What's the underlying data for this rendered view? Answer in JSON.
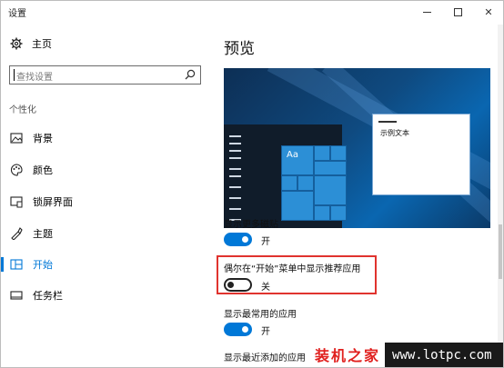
{
  "window": {
    "title": "设置",
    "controls": {
      "minimize_icon": "minimize-icon",
      "maximize_icon": "maximize-icon",
      "close_glyph": "✕"
    }
  },
  "sidebar": {
    "home_label": "主页",
    "search": {
      "placeholder": "查找设置",
      "value": ""
    },
    "section_label": "个性化",
    "items": [
      {
        "label": "背景",
        "icon": "image-icon"
      },
      {
        "label": "颜色",
        "icon": "palette-icon"
      },
      {
        "label": "锁屏界面",
        "icon": "lock-screen-icon"
      },
      {
        "label": "主题",
        "icon": "theme-icon"
      },
      {
        "label": "开始",
        "icon": "start-icon",
        "active": true
      },
      {
        "label": "任务栏",
        "icon": "taskbar-icon"
      }
    ]
  },
  "main": {
    "heading": "预览",
    "preview": {
      "sample_text": "示例文本",
      "tile_label": "Aa"
    },
    "options": [
      {
        "label": "显示更多磁贴",
        "state": "开",
        "on": true
      },
      {
        "label": "偶尔在“开始”菜单中显示推荐应用",
        "state": "关",
        "on": false,
        "highlighted": true
      },
      {
        "label": "显示最常用的应用",
        "state": "开",
        "on": true
      },
      {
        "label": "显示最近添加的应用"
      }
    ]
  },
  "watermark": {
    "brand": "装机之家",
    "url": "www.lotpc.com"
  },
  "colors": {
    "accent": "#0078d7",
    "highlight_border": "#e0332e",
    "watermark_red": "#e0201e"
  }
}
